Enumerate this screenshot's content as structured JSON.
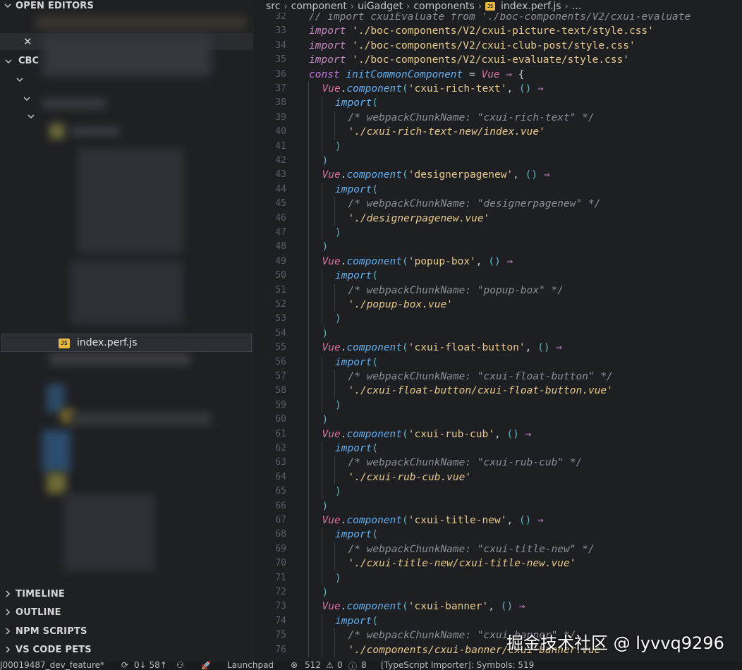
{
  "sidebar": {
    "open_editors": "OPEN EDITORS",
    "workspace": "CBC",
    "active_file": "index.perf.js",
    "sections": [
      "TIMELINE",
      "OUTLINE",
      "NPM SCRIPTS",
      "VS CODE PETS"
    ]
  },
  "breadcrumb": [
    "src",
    "component",
    "uiGadget",
    "components",
    "index.perf.js",
    "..."
  ],
  "editor": {
    "lines": [
      {
        "n": "32",
        "indent": 0,
        "t": [
          [
            "cm",
            "// import cxuiEvaluate from './boc-components/V2/cxui-evaluate"
          ]
        ]
      },
      {
        "n": "33",
        "indent": 0,
        "t": [
          [
            "kw",
            "import"
          ],
          [
            "pun",
            " "
          ],
          [
            "str",
            "'./boc-components/V2/cxui-picture-text/style.css'"
          ]
        ]
      },
      {
        "n": "34",
        "indent": 0,
        "t": [
          [
            "kw",
            "import"
          ],
          [
            "pun",
            " "
          ],
          [
            "str",
            "'./boc-components/V2/cxui-club-post/style.css'"
          ]
        ]
      },
      {
        "n": "35",
        "indent": 0,
        "t": [
          [
            "kw",
            "import"
          ],
          [
            "pun",
            " "
          ],
          [
            "str",
            "'./boc-components/V2/cxui-evaluate/style.css'"
          ]
        ]
      },
      {
        "n": "36",
        "indent": 0,
        "t": [
          [
            "kw2",
            "const"
          ],
          [
            "pun",
            " "
          ],
          [
            "fn",
            "initCommonComponent"
          ],
          [
            "pun",
            " = "
          ],
          [
            "obj",
            "Vue"
          ],
          [
            "arr",
            " ⇒ "
          ],
          [
            "pun",
            "{"
          ]
        ]
      },
      {
        "n": "37",
        "indent": 1,
        "t": [
          [
            "obj",
            "Vue"
          ],
          [
            "pun",
            "."
          ],
          [
            "fn",
            "component"
          ],
          [
            "par",
            "("
          ],
          [
            "str",
            "'cxui-rich-text'"
          ],
          [
            "pun",
            ", "
          ],
          [
            "par",
            "()"
          ],
          [
            "arr",
            " ⇒"
          ]
        ]
      },
      {
        "n": "38",
        "indent": 2,
        "t": [
          [
            "fn",
            "import"
          ],
          [
            "par",
            "("
          ]
        ]
      },
      {
        "n": "39",
        "indent": 3,
        "t": [
          [
            "cm",
            "/* webpackChunkName: \"cxui-rich-text\" */"
          ]
        ]
      },
      {
        "n": "40",
        "indent": 3,
        "t": [
          [
            "stri",
            "'./cxui-rich-text-new/index.vue'"
          ]
        ]
      },
      {
        "n": "41",
        "indent": 2,
        "t": [
          [
            "par",
            ")"
          ]
        ]
      },
      {
        "n": "42",
        "indent": 1,
        "t": [
          [
            "par",
            ")"
          ]
        ]
      },
      {
        "n": "43",
        "indent": 1,
        "t": [
          [
            "obj",
            "Vue"
          ],
          [
            "pun",
            "."
          ],
          [
            "fn",
            "component"
          ],
          [
            "par",
            "("
          ],
          [
            "str",
            "'designerpagenew'"
          ],
          [
            "pun",
            ", "
          ],
          [
            "par",
            "()"
          ],
          [
            "arr",
            " ⇒"
          ]
        ]
      },
      {
        "n": "44",
        "indent": 2,
        "t": [
          [
            "fn",
            "import"
          ],
          [
            "par",
            "("
          ]
        ]
      },
      {
        "n": "45",
        "indent": 3,
        "t": [
          [
            "cm",
            "/* webpackChunkName: \"designerpagenew\" */"
          ]
        ]
      },
      {
        "n": "46",
        "indent": 3,
        "t": [
          [
            "stri",
            "'./designerpagenew.vue'"
          ]
        ]
      },
      {
        "n": "47",
        "indent": 2,
        "t": [
          [
            "par",
            ")"
          ]
        ]
      },
      {
        "n": "48",
        "indent": 1,
        "t": [
          [
            "par",
            ")"
          ]
        ]
      },
      {
        "n": "49",
        "indent": 1,
        "t": [
          [
            "obj",
            "Vue"
          ],
          [
            "pun",
            "."
          ],
          [
            "fn",
            "component"
          ],
          [
            "par",
            "("
          ],
          [
            "str",
            "'popup-box'"
          ],
          [
            "pun",
            ", "
          ],
          [
            "par",
            "()"
          ],
          [
            "arr",
            " ⇒"
          ]
        ]
      },
      {
        "n": "50",
        "indent": 2,
        "t": [
          [
            "fn",
            "import"
          ],
          [
            "par",
            "("
          ]
        ]
      },
      {
        "n": "51",
        "indent": 3,
        "t": [
          [
            "cm",
            "/* webpackChunkName: \"popup-box\" */"
          ]
        ]
      },
      {
        "n": "52",
        "indent": 3,
        "t": [
          [
            "stri",
            "'./popup-box.vue'"
          ]
        ]
      },
      {
        "n": "53",
        "indent": 2,
        "t": [
          [
            "par",
            ")"
          ]
        ]
      },
      {
        "n": "54",
        "indent": 1,
        "t": [
          [
            "par",
            ")"
          ]
        ]
      },
      {
        "n": "55",
        "indent": 1,
        "t": [
          [
            "obj",
            "Vue"
          ],
          [
            "pun",
            "."
          ],
          [
            "fn",
            "component"
          ],
          [
            "par",
            "("
          ],
          [
            "str",
            "'cxui-float-button'"
          ],
          [
            "pun",
            ", "
          ],
          [
            "par",
            "()"
          ],
          [
            "arr",
            " ⇒"
          ]
        ]
      },
      {
        "n": "56",
        "indent": 2,
        "t": [
          [
            "fn",
            "import"
          ],
          [
            "par",
            "("
          ]
        ]
      },
      {
        "n": "57",
        "indent": 3,
        "t": [
          [
            "cm",
            "/* webpackChunkName: \"cxui-float-button\" */"
          ]
        ]
      },
      {
        "n": "58",
        "indent": 3,
        "t": [
          [
            "stri",
            "'./cxui-float-button/cxui-float-button.vue'"
          ]
        ]
      },
      {
        "n": "59",
        "indent": 2,
        "t": [
          [
            "par",
            ")"
          ]
        ]
      },
      {
        "n": "60",
        "indent": 1,
        "t": [
          [
            "par",
            ")"
          ]
        ]
      },
      {
        "n": "61",
        "indent": 1,
        "t": [
          [
            "obj",
            "Vue"
          ],
          [
            "pun",
            "."
          ],
          [
            "fn",
            "component"
          ],
          [
            "par",
            "("
          ],
          [
            "str",
            "'cxui-rub-cub'"
          ],
          [
            "pun",
            ", "
          ],
          [
            "par",
            "()"
          ],
          [
            "arr",
            " ⇒"
          ]
        ]
      },
      {
        "n": "62",
        "indent": 2,
        "t": [
          [
            "fn",
            "import"
          ],
          [
            "par",
            "("
          ]
        ]
      },
      {
        "n": "63",
        "indent": 3,
        "t": [
          [
            "cm",
            "/* webpackChunkName: \"cxui-rub-cub\" */"
          ]
        ]
      },
      {
        "n": "64",
        "indent": 3,
        "t": [
          [
            "stri",
            "'./cxui-rub-cub.vue'"
          ]
        ]
      },
      {
        "n": "65",
        "indent": 2,
        "t": [
          [
            "par",
            ")"
          ]
        ]
      },
      {
        "n": "66",
        "indent": 1,
        "t": [
          [
            "par",
            ")"
          ]
        ]
      },
      {
        "n": "67",
        "indent": 1,
        "t": [
          [
            "obj",
            "Vue"
          ],
          [
            "pun",
            "."
          ],
          [
            "fn",
            "component"
          ],
          [
            "par",
            "("
          ],
          [
            "str",
            "'cxui-title-new'"
          ],
          [
            "pun",
            ", "
          ],
          [
            "par",
            "()"
          ],
          [
            "arr",
            " ⇒"
          ]
        ]
      },
      {
        "n": "68",
        "indent": 2,
        "t": [
          [
            "fn",
            "import"
          ],
          [
            "par",
            "("
          ]
        ]
      },
      {
        "n": "69",
        "indent": 3,
        "t": [
          [
            "cm",
            "/* webpackChunkName: \"cxui-title-new\" */"
          ]
        ]
      },
      {
        "n": "70",
        "indent": 3,
        "t": [
          [
            "stri",
            "'./cxui-title-new/cxui-title-new.vue'"
          ]
        ]
      },
      {
        "n": "71",
        "indent": 2,
        "t": [
          [
            "par",
            ")"
          ]
        ]
      },
      {
        "n": "72",
        "indent": 1,
        "t": [
          [
            "par",
            ")"
          ]
        ]
      },
      {
        "n": "73",
        "indent": 1,
        "t": [
          [
            "obj",
            "Vue"
          ],
          [
            "pun",
            "."
          ],
          [
            "fn",
            "component"
          ],
          [
            "par",
            "("
          ],
          [
            "str",
            "'cxui-banner'"
          ],
          [
            "pun",
            ", "
          ],
          [
            "par",
            "()"
          ],
          [
            "arr",
            " ⇒"
          ]
        ]
      },
      {
        "n": "74",
        "indent": 2,
        "t": [
          [
            "fn",
            "import"
          ],
          [
            "par",
            "("
          ]
        ]
      },
      {
        "n": "75",
        "indent": 3,
        "t": [
          [
            "cm",
            "/* webpackChunkName: \"cxui-banner\" */"
          ]
        ]
      },
      {
        "n": "76",
        "indent": 3,
        "t": [
          [
            "stri",
            "'./components/cxui-banner/cxui-banner.vue'"
          ]
        ]
      }
    ]
  },
  "statusbar": {
    "branch": "J00019487_dev_feature*",
    "sync": "0↓ 58↑",
    "launchpad": "Launchpad",
    "errors": "512",
    "warnings": "0",
    "info": "8",
    "importer": "[TypeScript Importer]: Symbols: 519"
  },
  "watermark": "掘金技术社区 @ lyvvq9296",
  "colors": {
    "background": "#1e1f22",
    "keyword": "#c586c0",
    "string": "#e8c98a",
    "function": "#61afef",
    "comment": "#8b8f96",
    "js_icon": "#e8b73e"
  }
}
